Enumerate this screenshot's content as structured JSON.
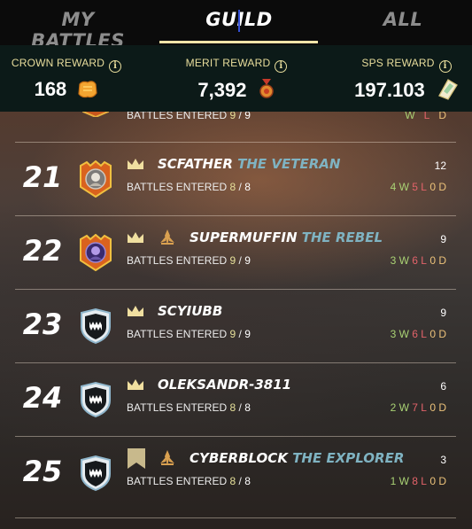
{
  "tabs": {
    "my_battles": "MY BATTLES",
    "guild": "GUILD",
    "all": "ALL",
    "active": "guild"
  },
  "rewards": {
    "crown": {
      "label": "CROWN REWARD",
      "value": "168",
      "icon": "crown-reward-icon"
    },
    "merit": {
      "label": "MERIT REWARD",
      "value": "7,392",
      "icon": "merit-medal-icon"
    },
    "sps": {
      "label": "SPS REWARD",
      "value": "197.103",
      "icon": "sps-token-icon"
    }
  },
  "labels": {
    "battles_entered": "BATTLES ENTERED",
    "slash": "/"
  },
  "partial_row": {
    "entered": "9",
    "total": "9",
    "w": "W",
    "l": "L",
    "d": "D"
  },
  "rows": [
    {
      "rank": "21",
      "player": "SCFATHER",
      "title": "THE VETERAN",
      "entered": "8",
      "total": "8",
      "score": "12",
      "w": "4 W",
      "l": "5 L",
      "d": "0 D",
      "badges": [
        "crown-icon"
      ]
    },
    {
      "rank": "22",
      "player": "SUPERMUFFIN",
      "title": "THE REBEL",
      "entered": "9",
      "total": "9",
      "score": "9",
      "w": "3 W",
      "l": "6 L",
      "d": "0 D",
      "badges": [
        "crown-icon",
        "rebel-emblem-icon"
      ]
    },
    {
      "rank": "23",
      "player": "SCYIUBB",
      "title": "",
      "entered": "9",
      "total": "9",
      "score": "9",
      "w": "3 W",
      "l": "6 L",
      "d": "0 D",
      "badges": [
        "crown-icon"
      ]
    },
    {
      "rank": "24",
      "player": "OLEKSANDR-3811",
      "title": "",
      "entered": "8",
      "total": "8",
      "score": "6",
      "w": "2 W",
      "l": "7 L",
      "d": "0 D",
      "badges": [
        "crown-icon"
      ]
    },
    {
      "rank": "25",
      "player": "CYBERBLOCK",
      "title": "THE EXPLORER",
      "entered": "8",
      "total": "8",
      "score": "3",
      "w": "1 W",
      "l": "8 L",
      "d": "0 D",
      "badges": [
        "banner-icon",
        "explorer-emblem-icon"
      ]
    }
  ],
  "colors": {
    "accent_gold": "#e8dd9c",
    "title_blue": "#7fb3c2",
    "win_green": "#a9d274",
    "loss_red": "#e3636a",
    "draw_orange": "#ecc27a"
  }
}
